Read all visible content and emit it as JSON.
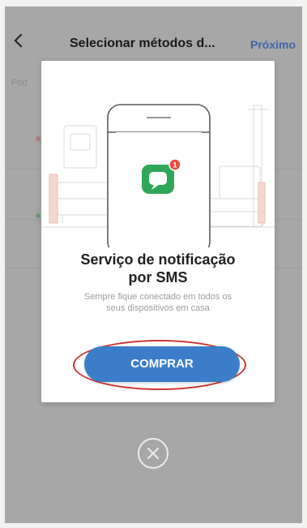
{
  "app_bar": {
    "back_icon": "chevron-left-icon",
    "title": "Selecionar métodos d...",
    "next_label": "Próximo"
  },
  "background": {
    "hint_text": "Pod"
  },
  "modal": {
    "illustration_icon": "message-bubble-icon",
    "notification_badge_count": "1",
    "title_line1": "Serviço de notificação",
    "title_line2": "por SMS",
    "subtitle_line1": "Sempre fique conectado em todos os",
    "subtitle_line2": "seus dispositivos em casa",
    "buy_label": "COMPRAR"
  },
  "close_icon": "close-icon",
  "colors": {
    "accent": "#3b7dc9",
    "highlight": "#c9352f",
    "message_green": "#2ea858",
    "badge_red": "#e54b3c"
  }
}
